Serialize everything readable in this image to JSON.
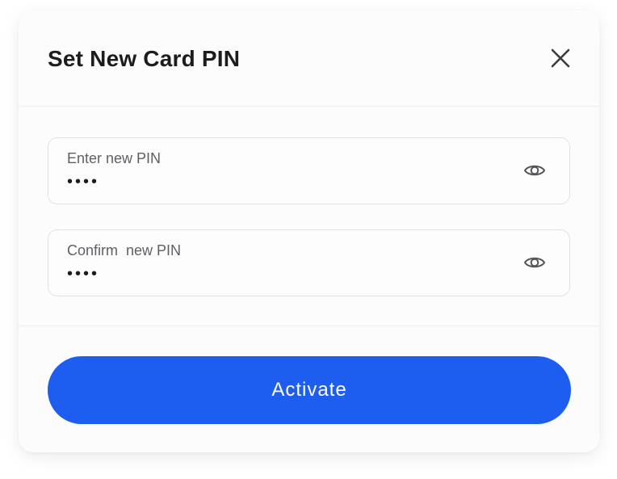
{
  "dialog": {
    "title": "Set New Card PIN",
    "close_icon": "close-icon"
  },
  "fields": [
    {
      "label": "Enter new PIN",
      "value": "••••",
      "icon": "eye-icon"
    },
    {
      "label": "Confirm  new PIN",
      "value": "••••",
      "icon": "eye-icon"
    }
  ],
  "actions": {
    "activate_label": "Activate"
  },
  "colors": {
    "primary": "#1d5ef0",
    "text": "#1c1c1e",
    "muted": "#5f5f66",
    "border": "#e2e2e2"
  }
}
